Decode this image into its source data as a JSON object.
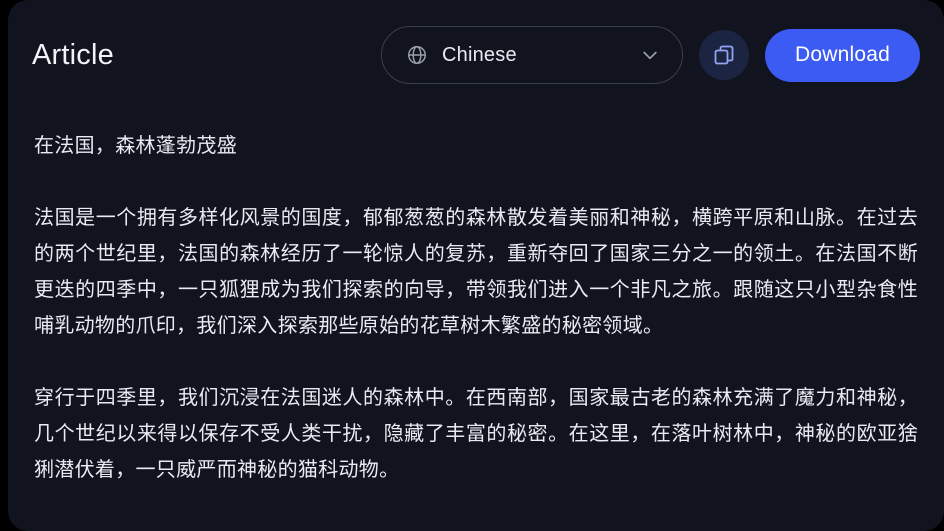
{
  "header": {
    "title": "Article",
    "language_select": {
      "icon": "globe-icon",
      "value": "Chinese",
      "chevron": "chevron-down-icon"
    },
    "copy_button": {
      "icon": "copy-icon",
      "label": ""
    },
    "download_button": {
      "label": "Download"
    }
  },
  "article": {
    "heading": "在法国，森林蓬勃茂盛",
    "paragraphs": [
      "法国是一个拥有多样化风景的国度，郁郁葱葱的森林散发着美丽和神秘，横跨平原和山脉。在过去的两个世纪里，法国的森林经历了一轮惊人的复苏，重新夺回了国家三分之一的领土。在法国不断更迭的四季中，一只狐狸成为我们探索的向导，带领我们进入一个非凡之旅。跟随这只小型杂食性哺乳动物的爪印，我们深入探索那些原始的花草树木繁盛的秘密领域。",
      "穿行于四季里，我们沉浸在法国迷人的森林中。在西南部，国家最古老的森林充满了魔力和神秘，几个世纪以来得以保存不受人类干扰，隐藏了丰富的秘密。在这里，在落叶树林中，神秘的欧亚猞猁潜伏着，一只威严而神秘的猫科动物。"
    ]
  },
  "colors": {
    "page_background": "#000000",
    "card_background": "#11131f",
    "accent_blue": "#3b5bf2",
    "copy_button_background": "#1b2440",
    "copy_icon_stroke": "#93a4f5",
    "text_primary": "#e9ebf2",
    "border_subtle": "#3a3f4d"
  }
}
